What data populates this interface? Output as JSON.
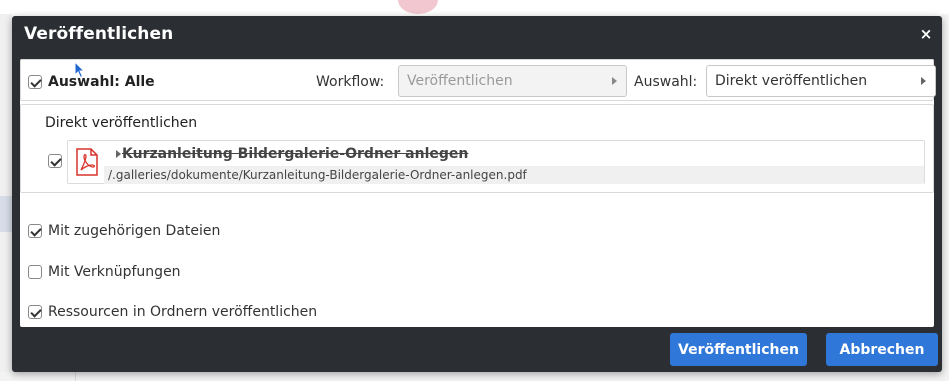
{
  "dialog": {
    "title": "Veröffentlichen",
    "close_glyph": "×"
  },
  "top_row": {
    "select_all_label": "Auswahl: Alle",
    "select_all_checked": true,
    "workflow_label": "Workflow:",
    "workflow_value": "Veröffentlichen",
    "selection_label": "Auswahl:",
    "selection_value": "Direkt veröffentlichen"
  },
  "group": {
    "title": "Direkt veröffentlichen",
    "items": [
      {
        "checked": true,
        "icon": "pdf-icon",
        "title": "Kurzanleitung Bildergalerie-Ordner anlegen",
        "path": "/.galleries/dokumente/Kurzanleitung-Bildergalerie-Ordner-anlegen.pdf"
      }
    ]
  },
  "options": [
    {
      "label": "Mit zugehörigen Dateien",
      "checked": true
    },
    {
      "label": "Mit Verknüpfungen",
      "checked": false
    },
    {
      "label": "Ressourcen in Ordnern veröffentlichen",
      "checked": true
    }
  ],
  "footer": {
    "publish_label": "Veröffentlichen",
    "cancel_label": "Abbrechen"
  },
  "colors": {
    "dialog_bg": "#2b2e33",
    "primary_button": "#2f77d8",
    "pdf_red": "#d9342b"
  }
}
